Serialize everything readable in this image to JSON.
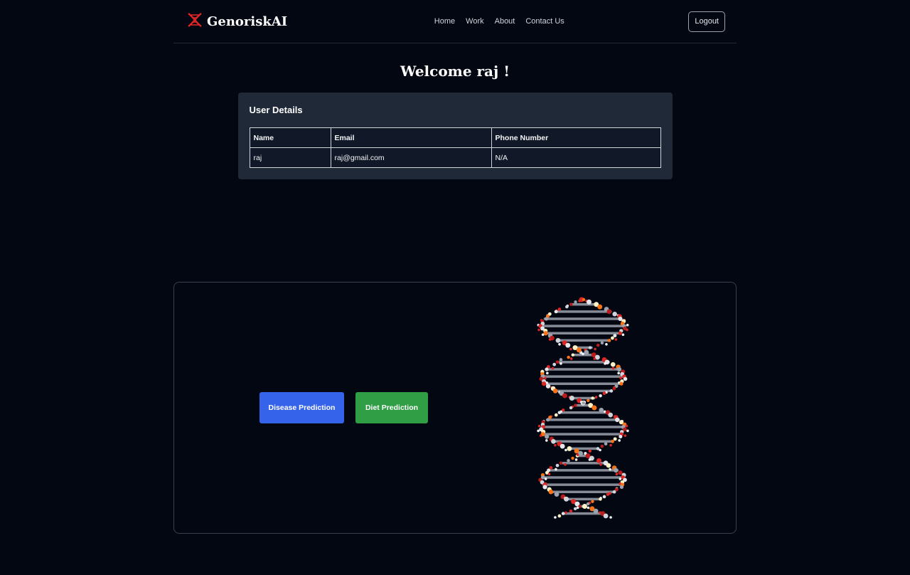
{
  "brand": {
    "name": "GenoriskAI",
    "logo_icon": "dna-helix-icon",
    "logo_color": "#dc2626"
  },
  "nav": {
    "items": [
      "Home",
      "Work",
      "About",
      "Contact Us"
    ]
  },
  "header": {
    "logout_label": "Logout"
  },
  "welcome": {
    "text": "Welcome raj !"
  },
  "user_details": {
    "title": "User Details",
    "columns": [
      "Name",
      "Email",
      "Phone Number"
    ],
    "rows": [
      [
        "raj",
        "raj@gmail.com",
        "N/A"
      ]
    ]
  },
  "actions": {
    "disease_label": "Disease Prediction",
    "diet_label": "Diet Prediction",
    "disease_color": "#3563e9",
    "diet_color": "#2f9e44"
  },
  "hero": {
    "image": "dna-double-helix-3d-model"
  },
  "colors": {
    "background": "#030712",
    "card": "#1f2937"
  }
}
